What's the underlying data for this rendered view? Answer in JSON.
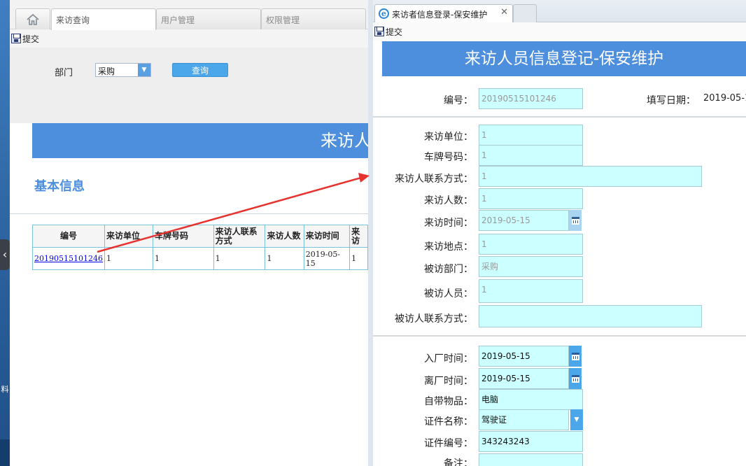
{
  "desktop": {
    "side_char": "料"
  },
  "main": {
    "tabs": [
      {
        "label": "来访查询"
      },
      {
        "label": "用户管理"
      },
      {
        "label": "权限管理"
      }
    ],
    "toolbar": {
      "submit_label": "提交"
    },
    "filter": {
      "dept_label": "部门",
      "dept_value": "采购",
      "query_label": "查询"
    },
    "banner_text": "来访人",
    "section_title": "基本信息",
    "table": {
      "headers": [
        "编号",
        "来访单位",
        "车牌号码",
        "来访人联系方式",
        "来访人数",
        "来访时间",
        "来访"
      ],
      "rows": [
        [
          "20190515101246",
          "1",
          "1",
          "1",
          "1",
          "2019-05-15",
          "1"
        ]
      ]
    }
  },
  "popup": {
    "tab_title": "来访者信息登录-保安维护",
    "toolbar": {
      "submit_label": "提交"
    },
    "title": "来访人员信息登记-保安维护",
    "fields": {
      "id": {
        "label": "编号：",
        "value": "20190515101246"
      },
      "fill_date": {
        "label": "填写日期：",
        "value": "2019-05-15"
      },
      "unit": {
        "label": "来访单位：",
        "value": "1"
      },
      "plate": {
        "label": "车牌号码：",
        "value": "1"
      },
      "contact": {
        "label": "来访人联系方式：",
        "value": "1"
      },
      "count": {
        "label": "来访人数：",
        "value": "1"
      },
      "visit_time": {
        "label": "来访时间：",
        "value": "2019-05-15"
      },
      "place": {
        "label": "来访地点：",
        "value": "1"
      },
      "dept": {
        "label": "被访部门：",
        "value": "采购"
      },
      "person": {
        "label": "被访人员：",
        "value": "1"
      },
      "person_contact": {
        "label": "被访人联系方式：",
        "value": ""
      },
      "enter_time": {
        "label": "入厂时间：",
        "value": "2019-05-15"
      },
      "leave_time": {
        "label": "离厂时间：",
        "value": "2019-05-15"
      },
      "items": {
        "label": "自带物品：",
        "value": "电脑"
      },
      "cert_name": {
        "label": "证件名称：",
        "value": "驾驶证"
      },
      "cert_no": {
        "label": "证件编号：",
        "value": "343243243"
      },
      "remark": {
        "label": "备注：",
        "value": ""
      }
    }
  },
  "colors": {
    "accent": "#4d8fdd",
    "field_bg": "#ccffff",
    "button": "#4ca6ea",
    "annotation_arrow": "#e8322f"
  }
}
